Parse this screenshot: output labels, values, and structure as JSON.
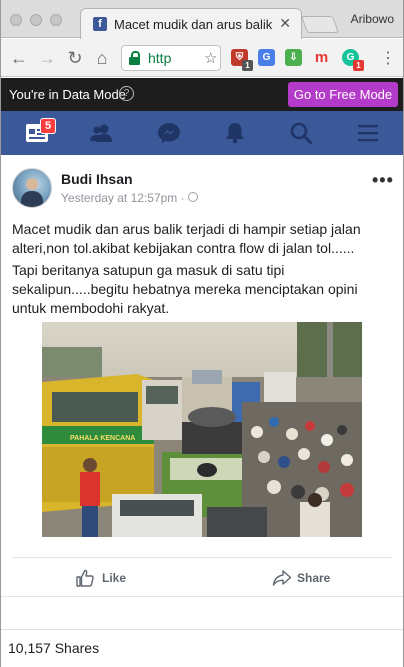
{
  "browser": {
    "tab_title": "Macet mudik dan arus balik t",
    "profile_name": "Aribowo",
    "url_text": "http",
    "favicon_letter": "f",
    "extensions": [
      {
        "icon": "shield-icon",
        "badge": "1",
        "color": "#c0392b"
      },
      {
        "icon": "translate-icon",
        "badge": "",
        "color": "#4a7ee8"
      },
      {
        "icon": "download-icon",
        "badge": "",
        "color": "#4caf50"
      },
      {
        "icon": "mail-icon",
        "badge": "",
        "color": "#e53935"
      },
      {
        "icon": "grammarly-icon",
        "badge": "1",
        "color": "#15c39a"
      }
    ]
  },
  "data_mode": {
    "label": "You're in Data Mode",
    "help_glyph": "?",
    "button_label": "Go to Free Mode"
  },
  "fb_nav": {
    "news_badge": "5",
    "icons": [
      "newsfeed-icon",
      "friends-icon",
      "messenger-icon",
      "notifications-icon",
      "search-icon",
      "menu-icon"
    ]
  },
  "post": {
    "author": "Budi Ihsan",
    "timestamp": "Yesterday at 12:57pm",
    "dot": "·",
    "more_glyph": "•••",
    "paragraph_1": "Macet mudik dan arus balik terjadi di hampir setiap jalan alteri,non tol.akibat kebijakan contra flow di jalan tol......",
    "paragraph_2": "Tapi beritanya satupun ga masuk di satu tipi sekalipun.....begitu hebatnya mereka menciptakan opini untuk membodohi rakyat.",
    "photo_bus_text": "PAHALA KENCANA",
    "like_label": "Like",
    "share_label": "Share",
    "shares_count": "10,157 Shares"
  },
  "colors": {
    "facebook_blue": "#3b5998",
    "free_mode_purple": "#b43bc9",
    "data_bar": "#1d1d1d"
  }
}
